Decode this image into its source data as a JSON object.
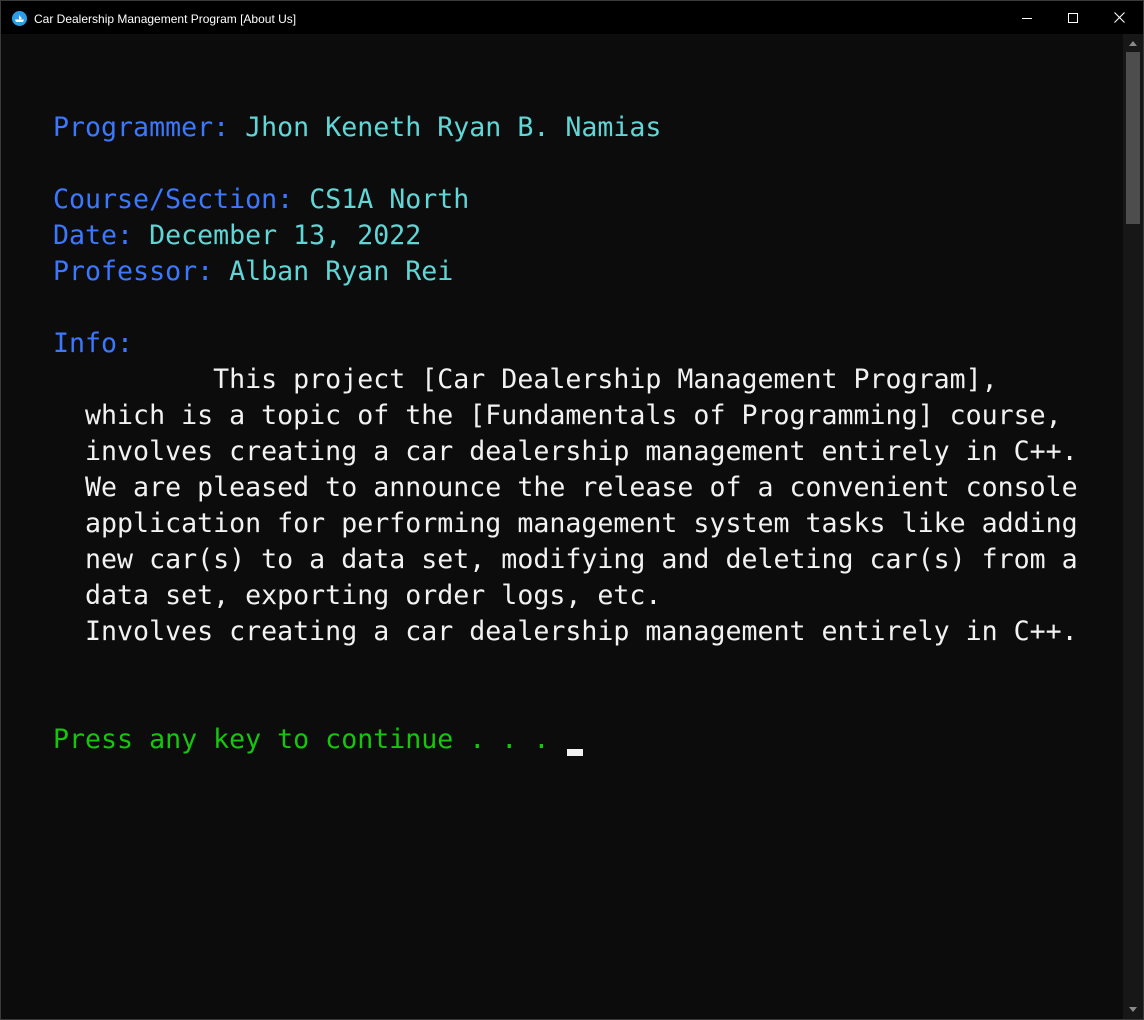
{
  "window": {
    "title": "Car Dealership Management Program [About Us]",
    "icons": {
      "app": "console-app-icon",
      "minimize": "minimize-icon",
      "maximize": "maximize-icon",
      "close": "close-icon"
    }
  },
  "console": {
    "programmer": {
      "label": "Programmer:",
      "value": "Jhon Keneth Ryan B. Namias"
    },
    "course": {
      "label": "Course/Section:",
      "value": "CS1A North"
    },
    "date": {
      "label": "Date:",
      "value": "December 13, 2022"
    },
    "professor": {
      "label": "Professor:",
      "value": "Alban Ryan Rei"
    },
    "info_label": "Info:",
    "info_lines": [
      "          This project [Car Dealership Management Program],",
      "  which is a topic of the [Fundamentals of Programming] course,",
      "  involves creating a car dealership management entirely in C++.",
      "  We are pleased to announce the release of a convenient console",
      "  application for performing management system tasks like adding",
      "  new car(s) to a data set, modifying and deleting car(s) from a",
      "  data set, exporting order logs, etc.",
      "  Involves creating a car dealership management entirely in C++."
    ],
    "prompt": "Press any key to continue . . . "
  },
  "colors": {
    "background": "#0c0c0c",
    "label": "#3b78ff",
    "value": "#61d6d6",
    "text": "#f2f2f2",
    "prompt": "#16c60c"
  }
}
